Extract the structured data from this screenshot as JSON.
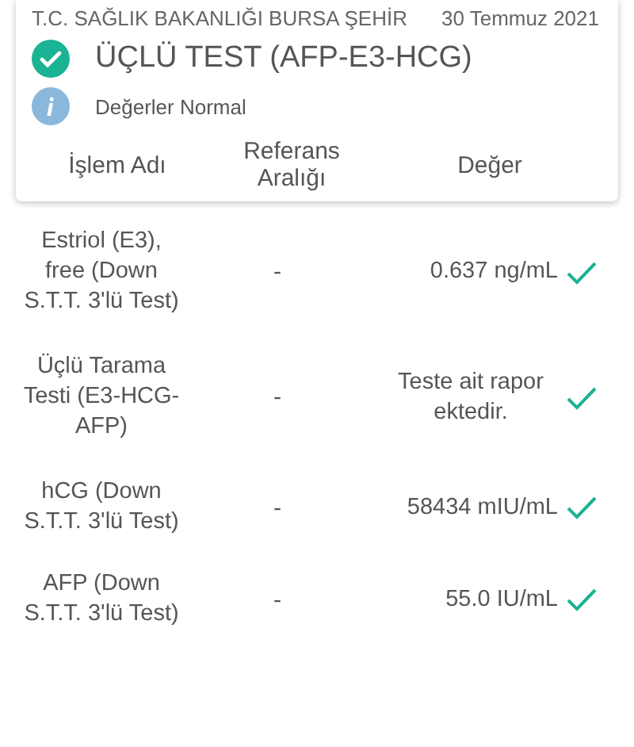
{
  "header": {
    "institution": "T.C. SAĞLIK BAKANLIĞI BURSA ŞEHİR",
    "date": "30 Temmuz 2021",
    "title": "ÜÇLÜ TEST (AFP-E3-HCG)",
    "normal": true,
    "note": "Değerler Normal"
  },
  "table": {
    "columns": [
      "İşlem Adı",
      "Referans Aralığı",
      "Değer"
    ],
    "rows": [
      {
        "name": "Estriol (E3), free (Down S.T.T. 3'lü Test)",
        "reference": "-",
        "value": "0.637 ng/mL",
        "normal": true
      },
      {
        "name": "Üçlü Tarama Testi (E3-HCG-AFP)",
        "reference": "-",
        "value": "Teste ait rapor ektedir.",
        "normal": true
      },
      {
        "name": "hCG (Down S.T.T. 3'lü Test)",
        "reference": "-",
        "value": "58434 mIU/mL",
        "normal": true
      },
      {
        "name": "AFP (Down S.T.T. 3'lü Test)",
        "reference": "-",
        "value": "55.0 IU/mL",
        "normal": true
      }
    ]
  }
}
